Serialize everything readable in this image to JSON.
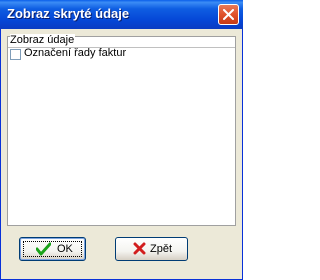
{
  "dialog": {
    "title": "Zobraz skryté údaje"
  },
  "group": {
    "label": "Zobraz údaje",
    "items": [
      {
        "label": "Označení řady faktur",
        "checked": false
      }
    ]
  },
  "buttons": {
    "ok_label": "OK",
    "back_label": "Zpět"
  },
  "colors": {
    "titlebar": "#0546d6",
    "close": "#e0512a",
    "ok_icon": "#1aa31a",
    "back_icon": "#d21e1e"
  },
  "icons": {
    "close": "close-icon",
    "ok": "checkmark-icon",
    "back": "x-icon"
  }
}
